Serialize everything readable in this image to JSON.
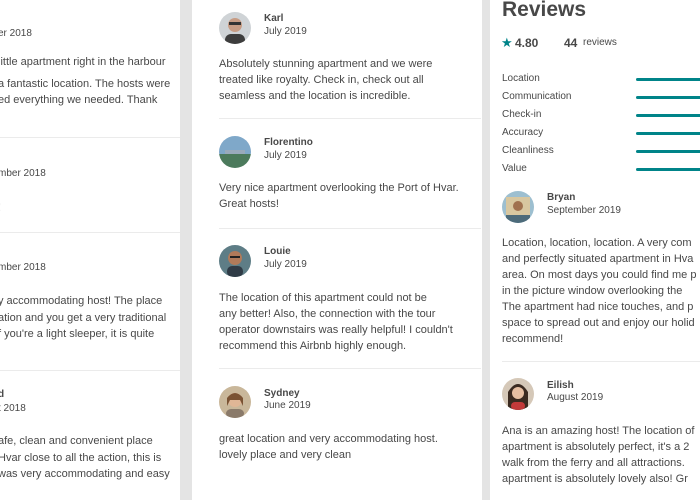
{
  "left_panel": {
    "reviews": [
      {
        "date": "er 2018",
        "text": [
          "little apartment right in the harbour",
          "a fantastic location. The hosts were",
          "ed everything we needed. Thank"
        ]
      },
      {
        "date": "mber 2018",
        "text": [
          "!"
        ]
      },
      {
        "date": "mber 2018",
        "text": [
          "y accommodating host! The place",
          "ation and you get a very traditional",
          "f you're a light sleeper, it is quite"
        ]
      },
      {
        "name": "d",
        "date": "t 2018",
        "text": [
          "afe, clean and convenient place",
          "Hvar close to all the action, this is",
          "was very accommodating and easy"
        ]
      }
    ]
  },
  "middle_panel": {
    "reviews": [
      {
        "name": "Karl",
        "date": "July 2019",
        "text": [
          "Absolutely stunning apartment and we were",
          "treated like royalty. Check in, check out all",
          "seamless and the location is incredible."
        ]
      },
      {
        "name": "Florentino",
        "date": "July 2019",
        "text": [
          "Very nice apartment overlooking the Port of Hvar.",
          "Great hosts!"
        ]
      },
      {
        "name": "Louie",
        "date": "July 2019",
        "text": [
          "The location of this apartment could not be",
          "any better!  Also, the connection with the tour",
          "operator downstairs was really helpful!  I couldn't",
          "recommend this Airbnb highly enough."
        ]
      },
      {
        "name": "Sydney",
        "date": "June 2019",
        "text": [
          "great location and very accommodating host.",
          "lovely place and very clean"
        ]
      }
    ]
  },
  "right_panel": {
    "title": "Reviews",
    "star_icon": "star-icon",
    "rating": "4.80",
    "review_count": "44",
    "review_count_label": "reviews",
    "accent_color": "#008489",
    "categories": [
      {
        "label": "Location",
        "value": 1.0
      },
      {
        "label": "Communication",
        "value": 1.0
      },
      {
        "label": "Check-in",
        "value": 1.0
      },
      {
        "label": "Accuracy",
        "value": 1.0
      },
      {
        "label": "Cleanliness",
        "value": 1.0
      },
      {
        "label": "Value",
        "value": 1.0
      }
    ],
    "reviews": [
      {
        "name": "Bryan",
        "date": "September 2019",
        "text": [
          "Location, location, location. A very com",
          "and perfectly situated apartment in Hva",
          "area. On most days you could find me p",
          "in the picture window overlooking the ",
          "The apartment had nice touches, and p",
          "space to spread out and enjoy our holid",
          "recommend!"
        ]
      },
      {
        "name": "Eilish",
        "date": "August 2019",
        "text": [
          "Ana is an amazing host! The location of",
          "apartment is absolutely perfect, it's a 2",
          "walk from the ferry and all attractions.",
          "apartment is absolutely lovely also! Gr"
        ]
      }
    ]
  }
}
